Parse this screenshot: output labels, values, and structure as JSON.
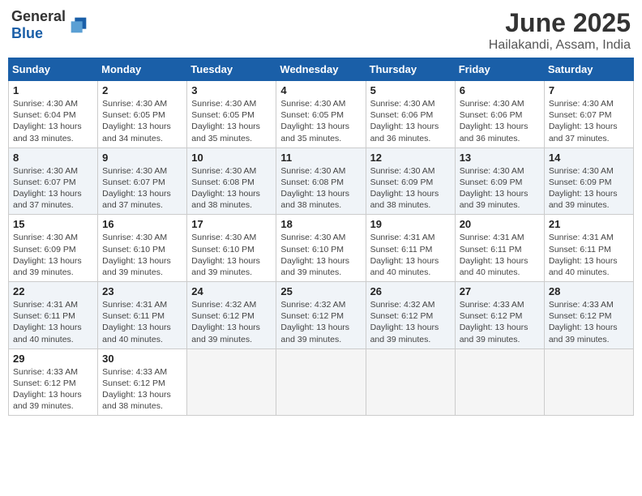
{
  "header": {
    "logo_general": "General",
    "logo_blue": "Blue",
    "month_title": "June 2025",
    "location": "Hailakandi, Assam, India"
  },
  "weekdays": [
    "Sunday",
    "Monday",
    "Tuesday",
    "Wednesday",
    "Thursday",
    "Friday",
    "Saturday"
  ],
  "weeks": [
    [
      {
        "day": "1",
        "info": "Sunrise: 4:30 AM\nSunset: 6:04 PM\nDaylight: 13 hours\nand 33 minutes."
      },
      {
        "day": "2",
        "info": "Sunrise: 4:30 AM\nSunset: 6:05 PM\nDaylight: 13 hours\nand 34 minutes."
      },
      {
        "day": "3",
        "info": "Sunrise: 4:30 AM\nSunset: 6:05 PM\nDaylight: 13 hours\nand 35 minutes."
      },
      {
        "day": "4",
        "info": "Sunrise: 4:30 AM\nSunset: 6:05 PM\nDaylight: 13 hours\nand 35 minutes."
      },
      {
        "day": "5",
        "info": "Sunrise: 4:30 AM\nSunset: 6:06 PM\nDaylight: 13 hours\nand 36 minutes."
      },
      {
        "day": "6",
        "info": "Sunrise: 4:30 AM\nSunset: 6:06 PM\nDaylight: 13 hours\nand 36 minutes."
      },
      {
        "day": "7",
        "info": "Sunrise: 4:30 AM\nSunset: 6:07 PM\nDaylight: 13 hours\nand 37 minutes."
      }
    ],
    [
      {
        "day": "8",
        "info": "Sunrise: 4:30 AM\nSunset: 6:07 PM\nDaylight: 13 hours\nand 37 minutes."
      },
      {
        "day": "9",
        "info": "Sunrise: 4:30 AM\nSunset: 6:07 PM\nDaylight: 13 hours\nand 37 minutes."
      },
      {
        "day": "10",
        "info": "Sunrise: 4:30 AM\nSunset: 6:08 PM\nDaylight: 13 hours\nand 38 minutes."
      },
      {
        "day": "11",
        "info": "Sunrise: 4:30 AM\nSunset: 6:08 PM\nDaylight: 13 hours\nand 38 minutes."
      },
      {
        "day": "12",
        "info": "Sunrise: 4:30 AM\nSunset: 6:09 PM\nDaylight: 13 hours\nand 38 minutes."
      },
      {
        "day": "13",
        "info": "Sunrise: 4:30 AM\nSunset: 6:09 PM\nDaylight: 13 hours\nand 39 minutes."
      },
      {
        "day": "14",
        "info": "Sunrise: 4:30 AM\nSunset: 6:09 PM\nDaylight: 13 hours\nand 39 minutes."
      }
    ],
    [
      {
        "day": "15",
        "info": "Sunrise: 4:30 AM\nSunset: 6:09 PM\nDaylight: 13 hours\nand 39 minutes."
      },
      {
        "day": "16",
        "info": "Sunrise: 4:30 AM\nSunset: 6:10 PM\nDaylight: 13 hours\nand 39 minutes."
      },
      {
        "day": "17",
        "info": "Sunrise: 4:30 AM\nSunset: 6:10 PM\nDaylight: 13 hours\nand 39 minutes."
      },
      {
        "day": "18",
        "info": "Sunrise: 4:30 AM\nSunset: 6:10 PM\nDaylight: 13 hours\nand 39 minutes."
      },
      {
        "day": "19",
        "info": "Sunrise: 4:31 AM\nSunset: 6:11 PM\nDaylight: 13 hours\nand 40 minutes."
      },
      {
        "day": "20",
        "info": "Sunrise: 4:31 AM\nSunset: 6:11 PM\nDaylight: 13 hours\nand 40 minutes."
      },
      {
        "day": "21",
        "info": "Sunrise: 4:31 AM\nSunset: 6:11 PM\nDaylight: 13 hours\nand 40 minutes."
      }
    ],
    [
      {
        "day": "22",
        "info": "Sunrise: 4:31 AM\nSunset: 6:11 PM\nDaylight: 13 hours\nand 40 minutes."
      },
      {
        "day": "23",
        "info": "Sunrise: 4:31 AM\nSunset: 6:11 PM\nDaylight: 13 hours\nand 40 minutes."
      },
      {
        "day": "24",
        "info": "Sunrise: 4:32 AM\nSunset: 6:12 PM\nDaylight: 13 hours\nand 39 minutes."
      },
      {
        "day": "25",
        "info": "Sunrise: 4:32 AM\nSunset: 6:12 PM\nDaylight: 13 hours\nand 39 minutes."
      },
      {
        "day": "26",
        "info": "Sunrise: 4:32 AM\nSunset: 6:12 PM\nDaylight: 13 hours\nand 39 minutes."
      },
      {
        "day": "27",
        "info": "Sunrise: 4:33 AM\nSunset: 6:12 PM\nDaylight: 13 hours\nand 39 minutes."
      },
      {
        "day": "28",
        "info": "Sunrise: 4:33 AM\nSunset: 6:12 PM\nDaylight: 13 hours\nand 39 minutes."
      }
    ],
    [
      {
        "day": "29",
        "info": "Sunrise: 4:33 AM\nSunset: 6:12 PM\nDaylight: 13 hours\nand 39 minutes."
      },
      {
        "day": "30",
        "info": "Sunrise: 4:33 AM\nSunset: 6:12 PM\nDaylight: 13 hours\nand 38 minutes."
      },
      {
        "day": "",
        "info": ""
      },
      {
        "day": "",
        "info": ""
      },
      {
        "day": "",
        "info": ""
      },
      {
        "day": "",
        "info": ""
      },
      {
        "day": "",
        "info": ""
      }
    ]
  ]
}
